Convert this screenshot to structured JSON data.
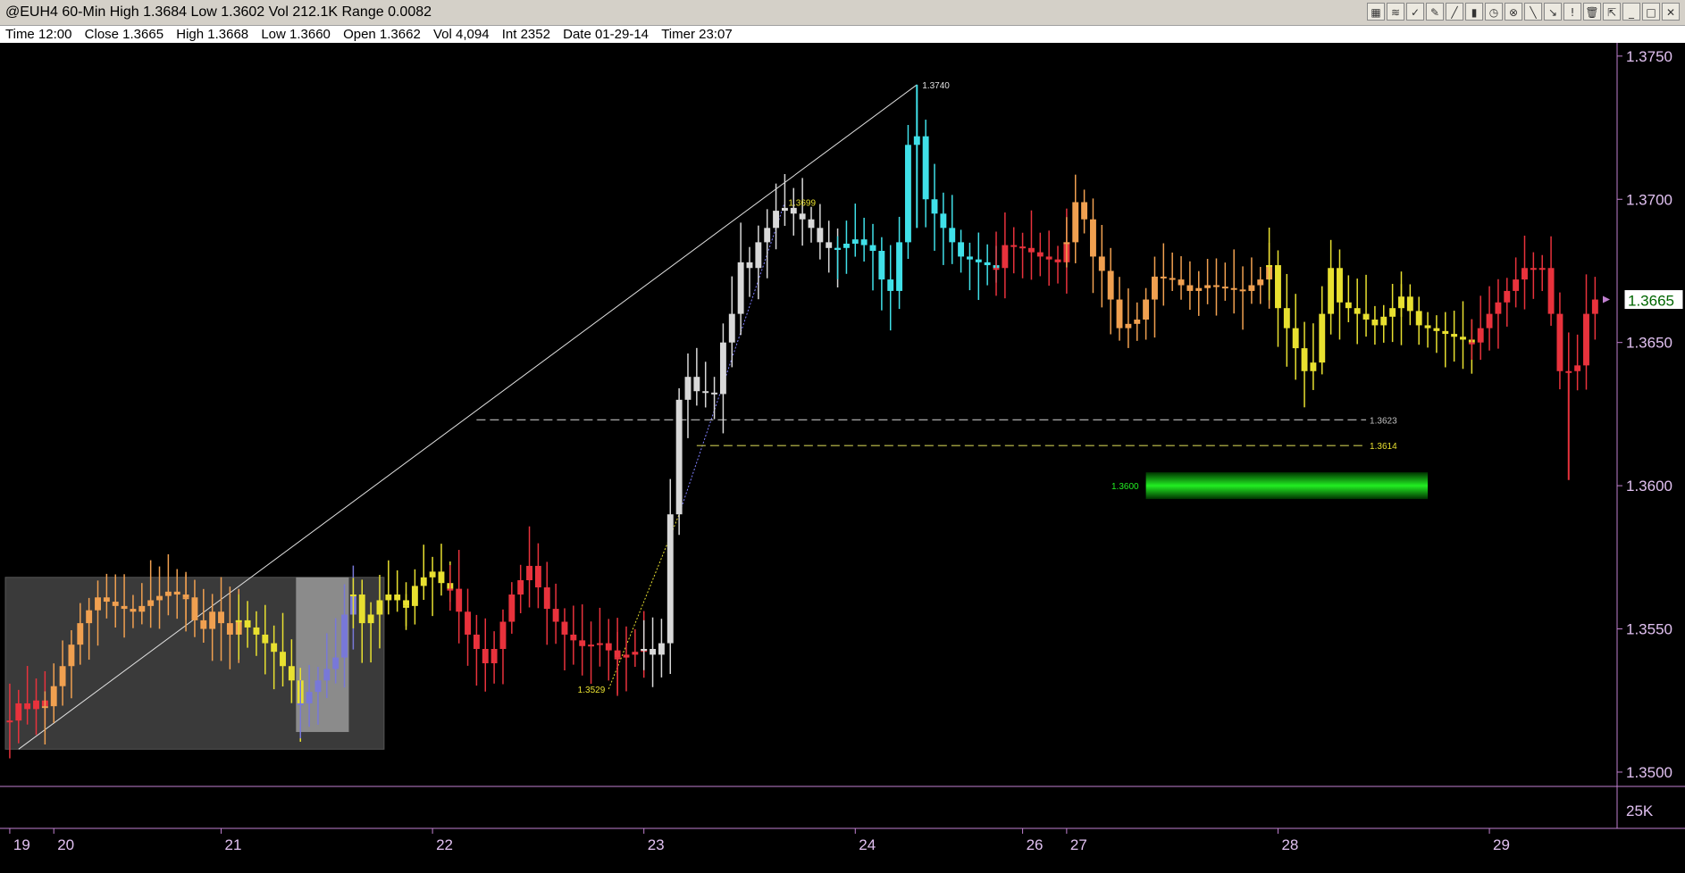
{
  "window": {
    "title": "@EUH4 60-Min High 1.3684 Low 1.3602 Vol 212.1K Range 0.0082"
  },
  "toolbar": {
    "icons": [
      "chart-type-icon",
      "draw-icon",
      "indicator-icon",
      "pencil-icon",
      "ruler-icon",
      "bar-icon",
      "clock-icon",
      "cross-icon",
      "line-icon",
      "arrow-icon",
      "marker-icon",
      "trash-icon",
      "zoom-icon",
      "minimize-icon",
      "restore-icon",
      "close-icon"
    ],
    "glyphs": [
      "▦",
      "≋",
      "✓",
      "✎",
      "╱",
      "▮",
      "◷",
      "⊗",
      "╲",
      "↘",
      "!",
      "🗑",
      "⇱",
      "_",
      "□",
      "✕"
    ]
  },
  "infobar": {
    "time": "Time 12:00",
    "close": "Close 1.3665",
    "high": "High 1.3668",
    "low": "Low 1.3660",
    "open": "Open 1.3662",
    "vol": "Vol 4,094",
    "int": "Int 2352",
    "date": "Date 01-29-14",
    "timer": "Timer 23:07"
  },
  "chart_data": {
    "type": "candlestick",
    "ylim": [
      1.3495,
      1.3754
    ],
    "y_ticks": [
      "1.3750",
      "1.3700",
      "1.3650",
      "1.3600",
      "1.3550",
      "1.3500"
    ],
    "last_price": "1.3665",
    "volume_label": "25K",
    "x_labels": [
      "19",
      "20",
      "21",
      "22",
      "23",
      "24",
      "26",
      "27",
      "28",
      "29"
    ],
    "x_label_bars": [
      0,
      5,
      24,
      48,
      72,
      96,
      115,
      120,
      144,
      168
    ],
    "segments": [
      {
        "color": "#e8323c",
        "path": [
          [
            0,
            1.3518
          ],
          [
            1,
            1.3524
          ],
          [
            2,
            1.3522
          ],
          [
            3,
            1.3525
          ],
          [
            4,
            1.3523
          ]
        ]
      },
      {
        "color": "#f0a050",
        "path": [
          [
            4,
            1.3523
          ],
          [
            6,
            1.3537
          ],
          [
            8,
            1.3552
          ],
          [
            10,
            1.3561
          ],
          [
            12,
            1.3558
          ],
          [
            14,
            1.3556
          ],
          [
            16,
            1.356
          ],
          [
            18,
            1.3563
          ],
          [
            20,
            1.3561
          ]
        ]
      },
      {
        "color": "#f0a050",
        "path": [
          [
            20,
            1.3561
          ],
          [
            21,
            1.3553
          ],
          [
            22,
            1.355
          ],
          [
            23,
            1.3556
          ],
          [
            24,
            1.3552
          ],
          [
            25,
            1.3548
          ],
          [
            26,
            1.3553
          ]
        ]
      },
      {
        "color": "#e8e030",
        "path": [
          [
            26,
            1.3553
          ],
          [
            28,
            1.3548
          ],
          [
            30,
            1.3542
          ],
          [
            32,
            1.3532
          ],
          [
            33,
            1.3524
          ]
        ]
      },
      {
        "color": "#7878d8",
        "path": [
          [
            33,
            1.3524
          ],
          [
            35,
            1.3532
          ],
          [
            36,
            1.3536
          ],
          [
            37,
            1.354
          ],
          [
            38,
            1.3555
          ],
          [
            39,
            1.3562
          ]
        ]
      },
      {
        "color": "#e8e030",
        "path": [
          [
            39,
            1.3562
          ],
          [
            40,
            1.3552
          ],
          [
            41,
            1.3555
          ],
          [
            42,
            1.356
          ],
          [
            43,
            1.3562
          ],
          [
            44,
            1.356
          ],
          [
            45,
            1.3558
          ]
        ]
      },
      {
        "color": "#e8e030",
        "path": [
          [
            45,
            1.3558
          ],
          [
            46,
            1.3565
          ],
          [
            47,
            1.3568
          ],
          [
            48,
            1.357
          ],
          [
            49,
            1.3566
          ],
          [
            50,
            1.3564
          ]
        ]
      },
      {
        "color": "#e8323c",
        "path": [
          [
            50,
            1.3564
          ],
          [
            52,
            1.3548
          ],
          [
            54,
            1.3538
          ],
          [
            55,
            1.3543
          ],
          [
            57,
            1.3562
          ],
          [
            59,
            1.3572
          ],
          [
            61,
            1.3557
          ],
          [
            63,
            1.3548
          ],
          [
            65,
            1.3544
          ],
          [
            67,
            1.3545
          ],
          [
            69,
            1.354
          ]
        ]
      },
      {
        "color": "#e8323c",
        "path": [
          [
            69,
            1.354
          ],
          [
            71,
            1.3542
          ],
          [
            72,
            1.3543
          ]
        ]
      },
      {
        "color": "#d8d8d8",
        "path": [
          [
            72,
            1.3543
          ],
          [
            73,
            1.3541
          ],
          [
            74,
            1.3545
          ],
          [
            75,
            1.359
          ],
          [
            76,
            1.363
          ],
          [
            77,
            1.3638
          ],
          [
            78,
            1.3633
          ],
          [
            80,
            1.3632
          ],
          [
            81,
            1.365
          ],
          [
            82,
            1.366
          ],
          [
            83,
            1.3678
          ],
          [
            84,
            1.3676
          ],
          [
            85,
            1.3685
          ],
          [
            86,
            1.369
          ],
          [
            87,
            1.3696
          ],
          [
            88,
            1.3697
          ],
          [
            90,
            1.3693
          ],
          [
            91,
            1.369
          ],
          [
            92,
            1.3685
          ],
          [
            93,
            1.3683
          ],
          [
            94,
            1.3683
          ]
        ]
      },
      {
        "color": "#40e0e8",
        "path": [
          [
            94,
            1.3683
          ],
          [
            96,
            1.3686
          ],
          [
            98,
            1.3682
          ],
          [
            99,
            1.3672
          ],
          [
            100,
            1.3668
          ],
          [
            101,
            1.3685
          ],
          [
            102,
            1.3719
          ],
          [
            103,
            1.3722
          ],
          [
            104,
            1.37
          ],
          [
            106,
            1.369
          ],
          [
            108,
            1.368
          ],
          [
            110,
            1.3678
          ],
          [
            112,
            1.3676
          ]
        ]
      },
      {
        "color": "#e8323c",
        "path": [
          [
            112,
            1.3676
          ],
          [
            113,
            1.3684
          ],
          [
            115,
            1.3683
          ],
          [
            117,
            1.368
          ],
          [
            119,
            1.3678
          ],
          [
            120,
            1.3685
          ]
        ]
      },
      {
        "color": "#f0a050",
        "path": [
          [
            120,
            1.3685
          ],
          [
            121,
            1.3699
          ],
          [
            122,
            1.3693
          ],
          [
            123,
            1.368
          ],
          [
            124,
            1.3675
          ],
          [
            125,
            1.3665
          ],
          [
            126,
            1.3655
          ],
          [
            128,
            1.3658
          ],
          [
            129,
            1.3665
          ],
          [
            130,
            1.3673
          ],
          [
            132,
            1.3672
          ],
          [
            134,
            1.3668
          ],
          [
            136,
            1.367
          ],
          [
            138,
            1.3669
          ],
          [
            140,
            1.3668
          ],
          [
            142,
            1.3672
          ],
          [
            143,
            1.3677
          ]
        ]
      },
      {
        "color": "#e8e030",
        "path": [
          [
            143,
            1.3677
          ],
          [
            144,
            1.3662
          ],
          [
            146,
            1.3648
          ],
          [
            147,
            1.364
          ],
          [
            148,
            1.3643
          ],
          [
            149,
            1.366
          ],
          [
            150,
            1.3676
          ],
          [
            151,
            1.3664
          ],
          [
            153,
            1.366
          ],
          [
            155,
            1.3656
          ],
          [
            157,
            1.3662
          ],
          [
            158,
            1.3666
          ]
        ]
      },
      {
        "color": "#e8e030",
        "path": [
          [
            158,
            1.3666
          ],
          [
            160,
            1.3656
          ],
          [
            162,
            1.3654
          ],
          [
            164,
            1.3652
          ],
          [
            166,
            1.365
          ]
        ]
      },
      {
        "color": "#e8323c",
        "path": [
          [
            166,
            1.365
          ],
          [
            168,
            1.366
          ],
          [
            170,
            1.3668
          ],
          [
            172,
            1.3676
          ],
          [
            174,
            1.3676
          ],
          [
            175,
            1.366
          ],
          [
            176,
            1.364
          ],
          [
            177,
            1.364
          ],
          [
            178,
            1.3642
          ],
          [
            179,
            1.366
          ],
          [
            180,
            1.3665
          ]
        ]
      }
    ],
    "annotations": {
      "high_label": "1.3740",
      "high_price": 1.374,
      "high_bar": 103,
      "mid_label": "1.3699",
      "mid_price": 1.3699,
      "mid_bar": 88,
      "low_label": "1.3529",
      "low_price": 1.3529,
      "low_bar": 68,
      "level1_label": "1.3623",
      "level1_price": 1.3623,
      "level1_start_bar": 53,
      "level1_end_bar": 154,
      "level2_label": "1.3614",
      "level2_price": 1.3614,
      "level2_start_bar": 78,
      "level2_end_bar": 154,
      "zone_label": "1.3600",
      "zone_price": 1.36,
      "zone_start_bar": 129,
      "zone_end_bar": 161,
      "trendline_from": [
        1,
        1.3508
      ],
      "trendline_to": [
        103,
        1.374
      ],
      "box1_bars": [
        0,
        42
      ],
      "box1_prices": [
        1.3508,
        1.3568
      ],
      "box2_bars": [
        33,
        38
      ],
      "box2_prices": [
        1.3514,
        1.3568
      ]
    }
  }
}
